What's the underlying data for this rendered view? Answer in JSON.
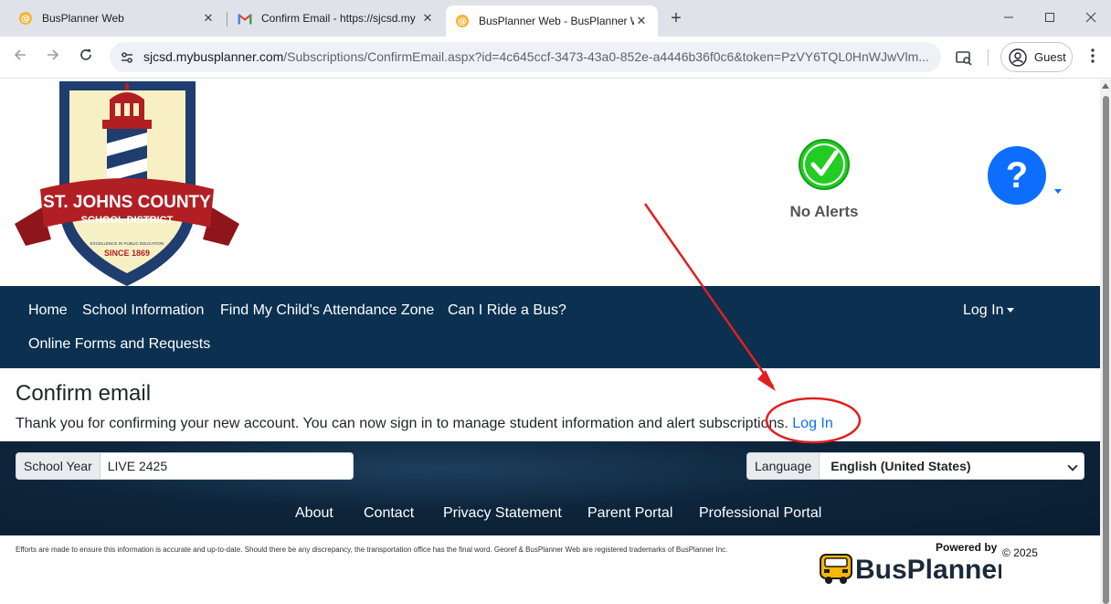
{
  "browser": {
    "tabs": [
      {
        "title": "BusPlanner Web",
        "icon": "busplanner-favicon",
        "active": false
      },
      {
        "title": "Confirm Email - https://sjcsd.my",
        "icon": "gmail-favicon",
        "active": false
      },
      {
        "title": "BusPlanner Web - BusPlanner W",
        "icon": "busplanner-favicon",
        "active": true
      }
    ],
    "new_tab": "+",
    "close_glyph": "✕",
    "url_host": "sjcsd.mybusplanner.com",
    "url_path": "/Subscriptions/ConfirmEmail.aspx?id=4c645ccf-3473-43a0-852e-a4446b36f0c6&token=PzVY6TQL0HnWJwVlm...",
    "profile_label": "Guest"
  },
  "header": {
    "logo_text": {
      "line1": "ST. JOHNS COUNTY",
      "line2": "SCHOOL DISTRICT",
      "motto": "EXCELLENCE IN PUBLIC EDUCATION",
      "since": "SINCE 1869"
    },
    "alerts_label": "No Alerts",
    "help_glyph": "?"
  },
  "nav": {
    "items": [
      "Home",
      "School Information",
      "Find My Child's Attendance Zone",
      "Can I Ride a Bus?",
      "Online Forms and Requests"
    ],
    "login": "Log In"
  },
  "content": {
    "title": "Confirm email",
    "message": "Thank you for confirming your new account. You can now sign in to manage student information and alert subscriptions.",
    "link": "Log In"
  },
  "footer": {
    "school_year_label": "School Year",
    "school_year_value": "LIVE 2425",
    "language_label": "Language",
    "language_value": "English (United States)",
    "links": [
      "About",
      "Contact",
      "Privacy Statement",
      "Parent Portal",
      "Professional Portal"
    ],
    "disclaimer": "Efforts are made to ensure this information is accurate and up-to-date. Should there be any discrepancy, the transportation office has the final word. Georef & BusPlanner Web are registered trademarks of BusPlanner Inc.",
    "powered_by": "Powered by",
    "brand": "BusPlanner",
    "copyright": "© 2025"
  },
  "colors": {
    "nav_bg": "#0b3050",
    "link_blue": "#0d6efd",
    "alert_green": "#22cc22",
    "annotation_red": "#e02020"
  }
}
